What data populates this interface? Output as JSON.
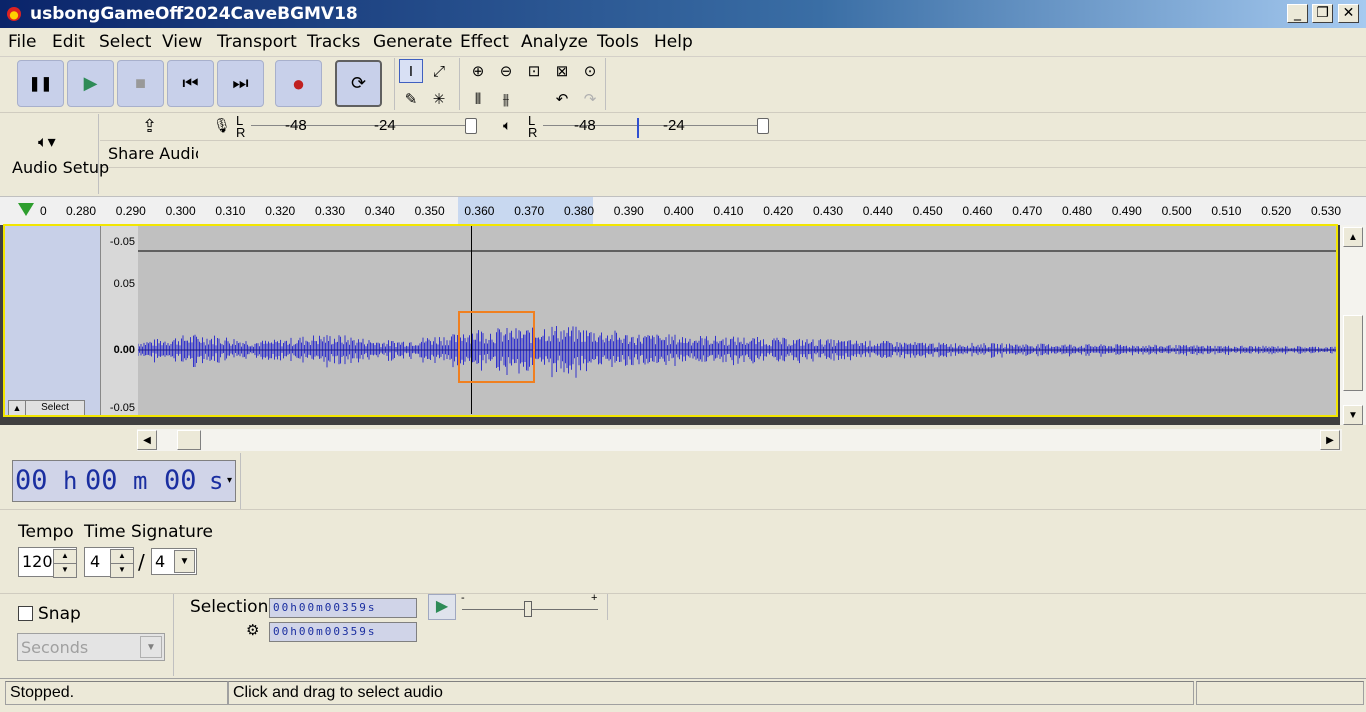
{
  "window": {
    "title": "usbongGameOff2024CaveBGMV18",
    "minimize": "_",
    "restore": "❐",
    "close": "✕"
  },
  "menu": [
    "File",
    "Edit",
    "Select",
    "View",
    "Transport",
    "Tracks",
    "Generate",
    "Effect",
    "Analyze",
    "Tools",
    "Help"
  ],
  "transport": {
    "pause": "❚❚",
    "play": "▶",
    "stop": "■",
    "skip_start": "⏮",
    "skip_end": "⏭",
    "record": "●",
    "loop": "⟳"
  },
  "tools": {
    "select_icon": "I",
    "envelope_icon": "⤢",
    "draw_icon": "✎",
    "multi_icon": "✳",
    "zoom_in": "⊕",
    "zoom_out": "⊖",
    "fit_selection": "⊡",
    "fit_project": "⊠",
    "zoom_toggle": "⊙",
    "trim": "⫴",
    "silence": "⫵",
    "undo": "↶",
    "redo": "↷"
  },
  "audio_setup": {
    "label": "Audio Setup",
    "icon": "speaker-icon"
  },
  "share_audio": {
    "label": "Share Audio",
    "icon": "upload-icon"
  },
  "meters": {
    "record": {
      "L": "L",
      "R": "R",
      "ticks": [
        "-48",
        "-24"
      ]
    },
    "play": {
      "L": "L",
      "R": "R",
      "ticks": [
        "-48",
        "-24"
      ]
    }
  },
  "ruler": {
    "ticks": [
      "0",
      "0.280",
      "0.290",
      "0.300",
      "0.310",
      "0.320",
      "0.330",
      "0.340",
      "0.350",
      "0.360",
      "0.370",
      "0.380",
      "0.390",
      "0.400",
      "0.410",
      "0.420",
      "0.430",
      "0.440",
      "0.450",
      "0.460",
      "0.470",
      "0.480",
      "0.490",
      "0.500",
      "0.510",
      "0.520",
      "0.530"
    ]
  },
  "track": {
    "select_label": "Select",
    "scale": [
      "-0.05",
      "0.05",
      "0.00",
      "-0.05"
    ],
    "wave_color": "#3333cc"
  },
  "time_display": {
    "h": "00",
    "h_unit": "h",
    "m": "00",
    "m_unit": "m",
    "s": "00",
    "s_unit": "s"
  },
  "tempo": {
    "label": "Tempo",
    "value": "120"
  },
  "time_signature": {
    "label": "Time Signature",
    "upper": "4",
    "slash": "/",
    "lower": "4"
  },
  "snap": {
    "label": "Snap",
    "unit": "Seconds"
  },
  "selection": {
    "label": "Selection",
    "start": "00h00m00359s",
    "end": "00h00m00359s"
  },
  "play_at_speed": {
    "minus": "-",
    "plus": "+",
    "level": 0.47
  },
  "status": {
    "state": "Stopped.",
    "hint": "Click and drag to select audio"
  },
  "colors": {
    "accent": "#f08020",
    "track_border": "#f2e600",
    "wave": "#3333cc"
  }
}
